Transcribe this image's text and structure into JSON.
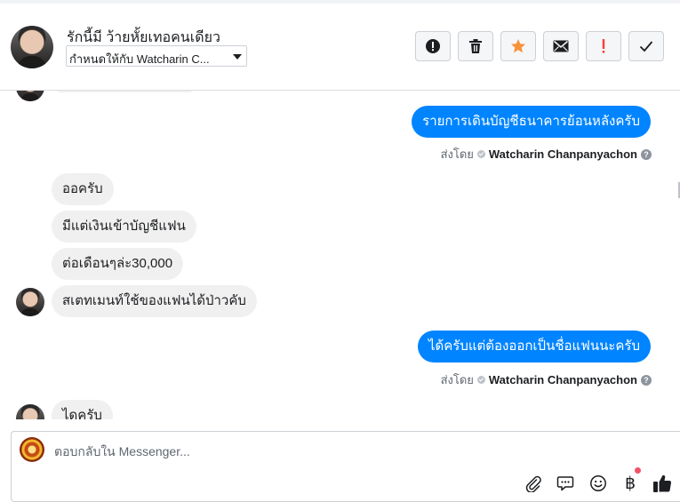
{
  "header": {
    "contact_name": "รักนี้มี ว้ายหั้ยเทอคนเดียว",
    "assign_label": "กำหนดให้กับ Watcharin C...",
    "actions": [
      {
        "name": "spam-icon",
        "color": "#1c1e21"
      },
      {
        "name": "trash-icon",
        "color": "#1c1e21"
      },
      {
        "name": "star-icon",
        "color": "#f7923b"
      },
      {
        "name": "envelope-icon",
        "color": "#1c1e21"
      },
      {
        "name": "follow-up-icon",
        "color": "#fa3e3e"
      },
      {
        "name": "check-icon",
        "color": "#1c1e21"
      }
    ]
  },
  "thread": {
    "messages": [
      {
        "dir": "out",
        "text": "รายการเดินบัญชีธนาคารย้อนหลังครับ"
      },
      {
        "dir": "in",
        "text": "ออครับ"
      },
      {
        "dir": "in",
        "text": "มีแต่เงินเข้าบัญชีแฟน"
      },
      {
        "dir": "in",
        "text": "ต่อเดือนๆล่ะ30,000"
      },
      {
        "dir": "in",
        "text": "สเตทเมนท์ใช้ของแฟนได้ป่าวคับ"
      },
      {
        "dir": "out",
        "text": "ได้ครับแต่ต้องออกเป็นชื่อแฟนนะครับ"
      },
      {
        "dir": "in",
        "text": "ไดครับ"
      }
    ],
    "sent_by_prefix": "ส่งโดย",
    "sent_by_agent": "Watcharin Chanpanyachon",
    "help_glyph": "?"
  },
  "composer": {
    "placeholder": "ตอบกลับใน Messenger...",
    "currency_glyph": "฿",
    "icons": [
      "paperclip-icon",
      "saved-reply-icon",
      "emoji-icon",
      "baht-payment-icon",
      "thumbs-up-icon"
    ],
    "accent": "#0084ff"
  }
}
